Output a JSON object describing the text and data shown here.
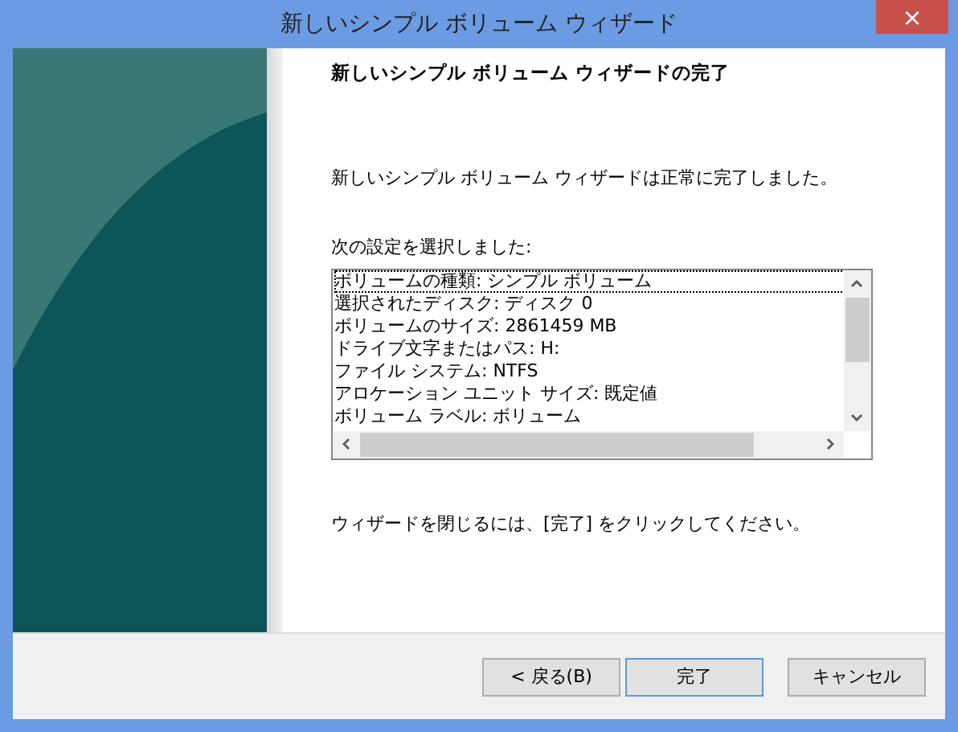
{
  "window": {
    "title": "新しいシンプル ボリューム ウィザード",
    "close": "×"
  },
  "heading": "新しいシンプル ボリューム ウィザードの完了",
  "message": "新しいシンプル ボリューム ウィザードは正常に完了しました。",
  "settings_label": "次の設定を選択しました:",
  "settings": [
    {
      "text": "ボリュームの種類: シンプル ボリューム",
      "selected": true
    },
    {
      "text": "選択されたディスク: ディスク 0",
      "selected": false
    },
    {
      "text": "ボリュームのサイズ: 2861459 MB",
      "selected": false
    },
    {
      "text": "ドライブ文字またはパス: H:",
      "selected": false
    },
    {
      "text": "ファイル システム: NTFS",
      "selected": false
    },
    {
      "text": "アロケーション ユニット サイズ: 既定値",
      "selected": false
    },
    {
      "text": "ボリューム ラベル: ボリューム",
      "selected": false
    }
  ],
  "close_hint": "ウィザードを閉じるには、[完了] をクリックしてください。",
  "buttons": [
    {
      "label": "< 戻る(B)",
      "default": false
    },
    {
      "label": "完了",
      "default": true
    },
    {
      "label": "キャンセル",
      "default": false
    }
  ]
}
